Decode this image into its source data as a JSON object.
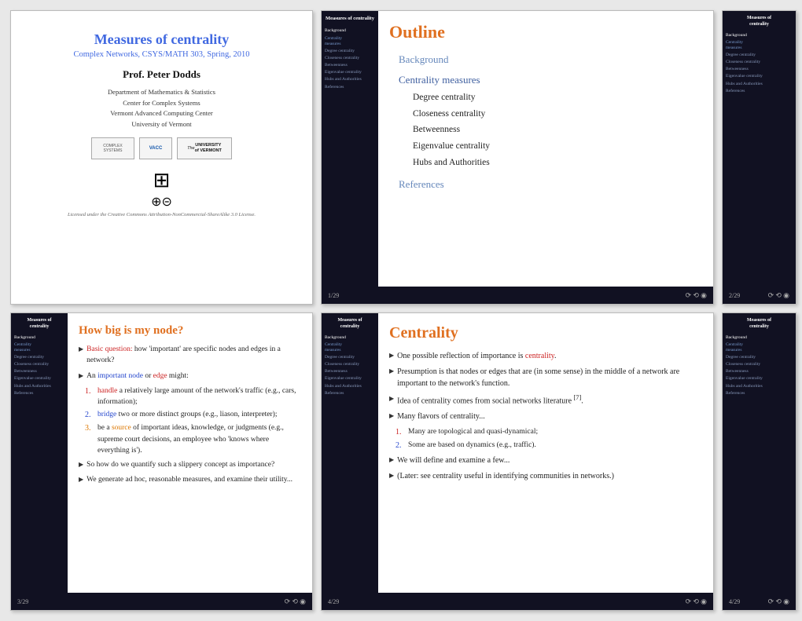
{
  "slides": {
    "slide1": {
      "title": "Measures of centrality",
      "subtitle": "Complex Networks, CSYS/MATH 303, Spring, 2010",
      "author": "Prof. Peter Dodds",
      "dept_lines": [
        "Department of Mathematics & Statistics",
        "Center for Complex Systems",
        "Vermont Advanced Computing Center",
        "University of Vermont"
      ],
      "logos": [
        "COMPLEX SYSTEMS LAB",
        "VACC",
        "UNIVERSITY of VERMONT"
      ],
      "license": "Licensed under the Creative Commons Attribution-NonCommercial-ShareAlike 3.0 License."
    },
    "slide2": {
      "title": "Outline",
      "sidebar_title": "Measures of\ncentrality",
      "sections": {
        "background": "Background",
        "centrality_measures": "Centrality measures",
        "sub_items": [
          "Degree centrality",
          "Closeness centrality",
          "Betweenness",
          "Eigenvalue centrality",
          "Hubs and Authorities"
        ],
        "references": "References"
      },
      "sidebar_items": [
        {
          "label": "Background",
          "active": true
        },
        {
          "label": "Centrality\nmeasures",
          "active": false
        },
        {
          "label": "Degree centrality",
          "active": false
        },
        {
          "label": "Closeness centrality",
          "active": false
        },
        {
          "label": "Betweenness",
          "active": false
        },
        {
          "label": "Eigenvalue centrality",
          "active": false
        },
        {
          "label": "Hubs and Authorities",
          "active": false
        },
        {
          "label": "References",
          "active": false
        }
      ],
      "page_num": "1/29",
      "controls": "⟳⟲◉"
    },
    "slide2b": {
      "sidebar_title": "Measures of\ncentrality",
      "sidebar_items": [
        {
          "label": "Background",
          "active": true
        },
        {
          "label": "Centrality\nmeasures",
          "active": false
        },
        {
          "label": "Degree centrality",
          "active": false
        },
        {
          "label": "Closeness centrality",
          "active": false
        },
        {
          "label": "Betweenness",
          "active": false
        },
        {
          "label": "Eigenvalue centrality",
          "active": false
        },
        {
          "label": "Hubs and Authorities",
          "active": false
        },
        {
          "label": "References",
          "active": false
        }
      ],
      "page_num": "2/29",
      "controls": "⟳⟲◉"
    },
    "slide3": {
      "title": "How big is my node?",
      "sidebar_title": "Measures of\ncentrality",
      "sidebar_items": [
        {
          "label": "Background",
          "active": true
        },
        {
          "label": "Centrality\nmeasures",
          "active": false
        },
        {
          "label": "Degree centrality",
          "active": false
        },
        {
          "label": "Closeness centrality",
          "active": false
        },
        {
          "label": "Betweenness",
          "active": false
        },
        {
          "label": "Eigenvalue centrality",
          "active": false
        },
        {
          "label": "Hubs and Authorities",
          "active": false
        },
        {
          "label": "References",
          "active": false
        }
      ],
      "bullets": [
        {
          "text_before": "",
          "highlight": "Basic question:",
          "highlight_color": "red",
          "text_after": " how 'important' are specific nodes and edges in a network?"
        },
        {
          "text_before": "An ",
          "highlight1": "important node",
          "h1_color": "blue",
          "text_mid": " or ",
          "highlight2": "edge",
          "h2_color": "red",
          "text_after": " might:"
        }
      ],
      "sub_bullets": [
        {
          "num": "1.",
          "num_color": "red",
          "text_before": "",
          "highlight": "handle",
          "h_color": "red",
          "text_after": " a relatively large amount of the network's traffic (e.g., cars, information);"
        },
        {
          "num": "2.",
          "num_color": "blue",
          "text_before": "",
          "highlight": "bridge",
          "h_color": "blue",
          "text_after": " two or more distinct groups (e.g., liason, interpreter);"
        },
        {
          "num": "3.",
          "num_color": "orange",
          "text_before": "be a ",
          "highlight": "source",
          "h_color": "orange",
          "text_after": " of important ideas, knowledge, or judgments (e.g., supreme court decisions, an employee who 'knows where everything is')."
        }
      ],
      "more_bullets": [
        "So how do we quantify such a slippery concept as importance?",
        "We generate ad hoc, reasonable measures, and examine their utility..."
      ],
      "page_num": "3/29",
      "controls": "⟳⟲◉"
    },
    "slide4": {
      "title": "Centrality",
      "sidebar_title": "Measures of\ncentrality",
      "sidebar_items": [
        {
          "label": "Background",
          "active": true
        },
        {
          "label": "Centrality\nmeasures",
          "active": false
        },
        {
          "label": "Degree centrality",
          "active": false
        },
        {
          "label": "Closeness centrality",
          "active": false
        },
        {
          "label": "Betweenness",
          "active": false
        },
        {
          "label": "Eigenvalue centrality",
          "active": false
        },
        {
          "label": "Hubs and Authorities",
          "active": false
        },
        {
          "label": "References",
          "active": false
        }
      ],
      "bullets": [
        "One possible reflection of importance is [centrality].",
        "Presumption is that nodes or edges that are (in some sense) in the middle of a network are important to the network's function.",
        "Idea of centrality comes from social networks literature [7].",
        "Many flavors of centrality..."
      ],
      "sub_bullets_centrality": [
        "Many are topological and quasi-dynamical;",
        "Some are based on dynamics (e.g., traffic)."
      ],
      "more_bullets": [
        "We will define and examine a few...",
        "(Later: see centrality useful in identifying communities in networks.)"
      ],
      "page_num": "4/29",
      "controls": "⟳⟲◉"
    }
  }
}
